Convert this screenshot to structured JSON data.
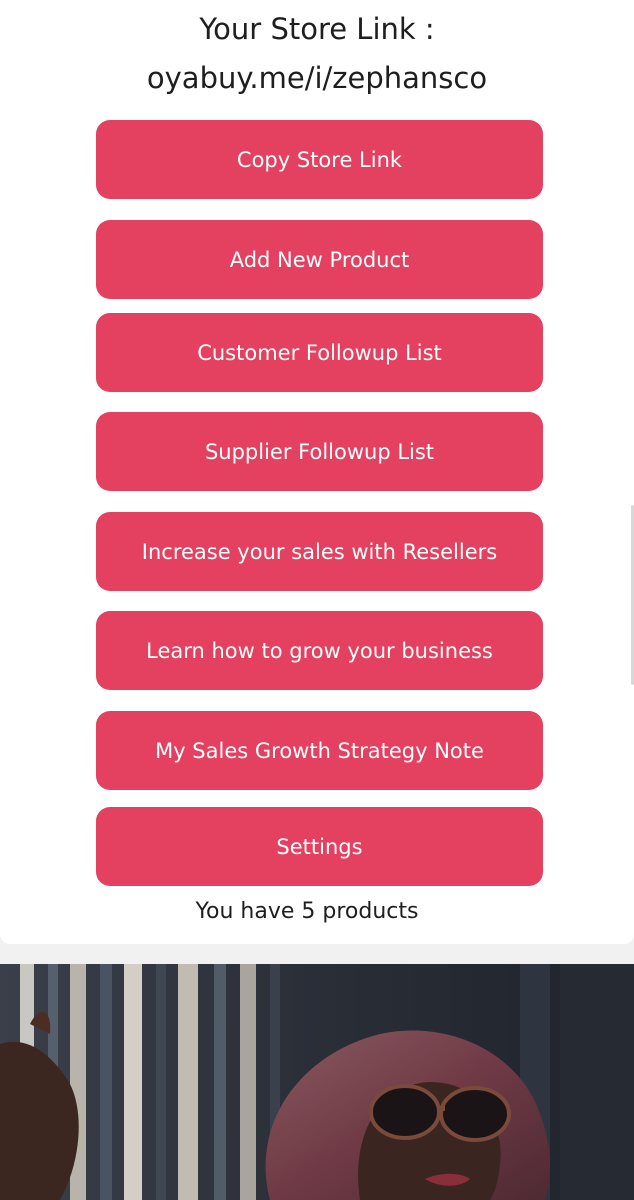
{
  "store": {
    "title": "Your Store Link :",
    "url": "oyabuy.me/i/zephansco"
  },
  "buttons": {
    "copy_link": "Copy Store Link",
    "add_product": "Add New Product",
    "customer_followup": "Customer Followup List",
    "supplier_followup": "Supplier Followup List",
    "resellers": "Increase your sales with Resellers",
    "learn_grow": "Learn how to grow your business",
    "strategy_note": "My Sales Growth Strategy Note",
    "settings": "Settings"
  },
  "product_count": "You have 5 products",
  "colors": {
    "button": "#e4405f",
    "button_text": "#ffffff",
    "background": "#f1f1f1"
  }
}
